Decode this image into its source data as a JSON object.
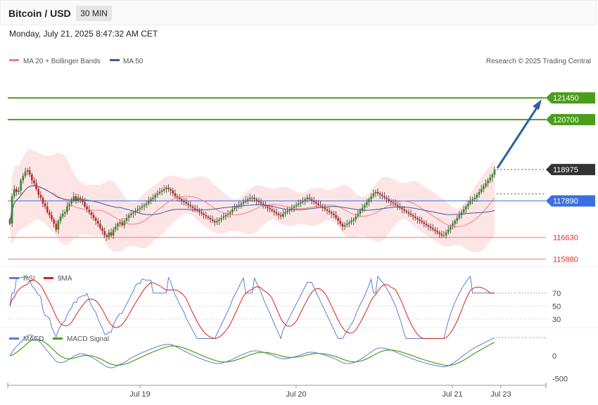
{
  "header": {
    "title": "Bitcoin / USD",
    "timeframe": "30 MIN"
  },
  "datetime": "Monday, July 21, 2025 8:47:32 AM CET",
  "credit": "Research © 2025 Trading Central",
  "legend": {
    "price": [
      {
        "label": "MA 20 + Bollinger Bands",
        "color": "#f08080"
      },
      {
        "label": "MA 50",
        "color": "#3a5a9a"
      }
    ],
    "rsi": [
      {
        "label": "RSI",
        "color": "#5b7fd6"
      },
      {
        "label": "9MA",
        "color": "#d62020"
      }
    ],
    "macd": [
      {
        "label": "MACD",
        "color": "#5b7fd6"
      },
      {
        "label": "MACD Signal",
        "color": "#4a9e1a"
      }
    ]
  },
  "chart_data": {
    "type": "candlestick",
    "instrument": "Bitcoin / USD",
    "interval": "30 MIN",
    "x_ticks": [
      "Jul 19",
      "Jul 20",
      "Jul 21",
      "Jul 23"
    ],
    "price_range": [
      115600,
      122500
    ],
    "closes": [
      117100,
      118050,
      118300,
      118200,
      118250,
      118600,
      118750,
      118900,
      118950,
      118800,
      118600,
      118500,
      118300,
      118100,
      118000,
      117800,
      117700,
      117500,
      117400,
      117250,
      117100,
      116900,
      117200,
      117350,
      117450,
      117500,
      117700,
      117800,
      117900,
      118050,
      117900,
      118000,
      117950,
      117850,
      117700,
      117600,
      117500,
      117400,
      117300,
      117200,
      117100,
      116950,
      116850,
      116700,
      116650,
      116800,
      116700,
      116900,
      117000,
      117100,
      117150,
      117050,
      117200,
      117300,
      117400,
      117450,
      117500,
      117550,
      117600,
      117650,
      117700,
      117750,
      117800,
      117900,
      117950,
      118000,
      118100,
      118150,
      118200,
      118250,
      118300,
      118350,
      118300,
      118250,
      118150,
      118050,
      118000,
      117950,
      117900,
      117850,
      117800,
      117750,
      117700,
      117650,
      117600,
      117550,
      117500,
      117450,
      117400,
      117350,
      117300,
      117250,
      117200,
      117150,
      117200,
      117250,
      117300,
      117350,
      117400,
      117450,
      117500,
      117600,
      117650,
      117700,
      117750,
      117800,
      117850,
      117900,
      117950,
      118000,
      118000,
      117950,
      117900,
      117850,
      117800,
      117750,
      117700,
      117650,
      117600,
      117550,
      117500,
      117450,
      117400,
      117350,
      117450,
      117500,
      117550,
      117600,
      117650,
      117700,
      117750,
      117800,
      117850,
      117900,
      117950,
      118000,
      117950,
      117900,
      117850,
      117800,
      117750,
      117700,
      117650,
      117600,
      117550,
      117500,
      117450,
      117400,
      117300,
      117200,
      117100,
      117000,
      117050,
      117100,
      117150,
      117200,
      117250,
      117350,
      117450,
      117550,
      117650,
      117750,
      117850,
      117950,
      118050,
      118150,
      118200,
      118150,
      118100,
      118050,
      118000,
      117950,
      117900,
      117850,
      117800,
      117750,
      117700,
      117650,
      117600,
      117550,
      117500,
      117450,
      117400,
      117350,
      117300,
      117250,
      117200,
      117150,
      117100,
      117050,
      117000,
      116950,
      116900,
      116850,
      116800,
      116750,
      116700,
      116700,
      116800,
      116900,
      117000,
      117100,
      117200,
      117300,
      117400,
      117500,
      117600,
      117700,
      117800,
      117900,
      117950,
      118000,
      118100,
      118200,
      118300,
      118400,
      118500,
      118600,
      118700,
      118800,
      118975
    ],
    "series": [
      {
        "name": "MA 20 + Bollinger Bands"
      },
      {
        "name": "MA 50"
      }
    ],
    "levels": [
      {
        "value": 121450,
        "label": "121450",
        "color": "#4a9e1a",
        "kind": "resistance"
      },
      {
        "value": 120700,
        "label": "120700",
        "color": "#4a9e1a",
        "kind": "resistance"
      },
      {
        "value": 118975,
        "label": "118975",
        "color": "#333333",
        "kind": "last"
      },
      {
        "value": 117890,
        "label": "117890",
        "color": "#3b6fe0",
        "kind": "pivot"
      },
      {
        "value": 116630,
        "label": "116630",
        "color": "#e0302a",
        "kind": "support"
      },
      {
        "value": 115880,
        "label": "115880",
        "color": "#e0302a",
        "kind": "support"
      }
    ],
    "target_arrow": {
      "from": 118975,
      "to": 121450
    },
    "rsi": {
      "ticks": [
        70,
        50,
        30
      ],
      "range": [
        20,
        85
      ]
    },
    "macd": {
      "ticks": [
        0,
        -500
      ],
      "range": [
        -650,
        250
      ]
    }
  }
}
